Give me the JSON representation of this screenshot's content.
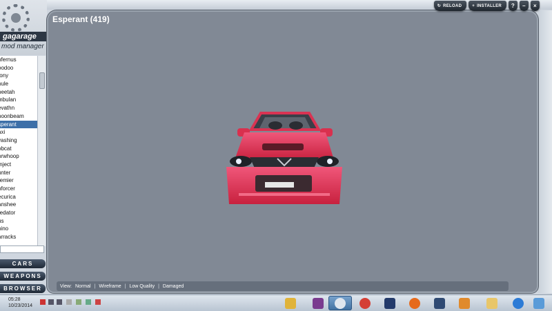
{
  "app": {
    "logo_wordmark": "gagarage",
    "logo_sub": "mod manager"
  },
  "top_buttons": {
    "reload_label": "RELOAD",
    "installer_label": "INSTALLER"
  },
  "car_list": {
    "items": [
      "nfernus",
      "oodoo",
      "tony",
      "nule",
      "heetah",
      "mbulan",
      "evathn",
      "noonbeam",
      "sperant",
      "axi",
      "vashing",
      "obcat",
      "nrwhoop",
      "fnject",
      "unter",
      "remier",
      "nforcer",
      "ecurica",
      "anshee",
      "redator",
      "us",
      "nino",
      "arracks"
    ],
    "selected_index": 8
  },
  "nav_buttons": {
    "cars": "CARS",
    "weapons": "WEAPONS",
    "browser": "BROWSER"
  },
  "viewer": {
    "title": "Esperant (419)",
    "car_color": "#e8344e"
  },
  "view_bar": {
    "label": "View:",
    "modes": [
      "Normal",
      "Wireframe",
      "Low Quality",
      "Damaged"
    ]
  },
  "taskbar": {
    "time": "05:28",
    "date": "10/23/2014",
    "apps": [
      {
        "icon": "paint-icon"
      },
      {
        "icon": "winrar-icon"
      },
      {
        "icon": "gear-app-icon",
        "active": true
      },
      {
        "icon": "chrome-icon"
      },
      {
        "icon": "bluetooth-icon"
      },
      {
        "icon": "firefox-icon"
      },
      {
        "icon": "pen-app-icon"
      },
      {
        "icon": "media-player-icon"
      },
      {
        "icon": "folder-icon"
      },
      {
        "icon": "ie-icon"
      },
      {
        "icon": "windows-icon"
      }
    ]
  }
}
